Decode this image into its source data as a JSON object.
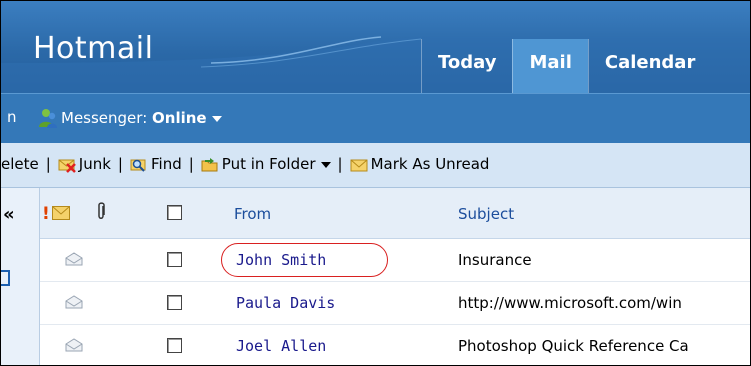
{
  "header": {
    "brand": "Hotmail",
    "tabs": [
      {
        "label": "Today",
        "active": false
      },
      {
        "label": "Mail",
        "active": true
      },
      {
        "label": "Calendar",
        "active": false
      }
    ]
  },
  "messenger": {
    "lead_fragment": "n",
    "label": "Messenger:",
    "status": "Online"
  },
  "toolbar": {
    "delete_label": "elete",
    "junk_label": "Junk",
    "find_label": "Find",
    "put_in_folder_label": "Put in Folder",
    "mark_unread_label": "Mark As Unread",
    "separator": "|"
  },
  "list": {
    "collapse_glyph": "«",
    "importance_glyph": "!",
    "columns": {
      "from": "From",
      "subject": "Subject"
    },
    "rows": [
      {
        "from": "John Smith",
        "subject": "Insurance",
        "highlighted": true
      },
      {
        "from": "Paula Davis",
        "subject": "http://www.microsoft.com/win"
      },
      {
        "from": "Joel Allen",
        "subject": "Photoshop Quick Reference Ca"
      }
    ]
  },
  "colors": {
    "header": "#2b69a8",
    "active_tab": "#4f96d3",
    "toolbar": "#d5e5f5",
    "highlight_circle": "#d92020",
    "link_blue": "#1b4d9c"
  }
}
